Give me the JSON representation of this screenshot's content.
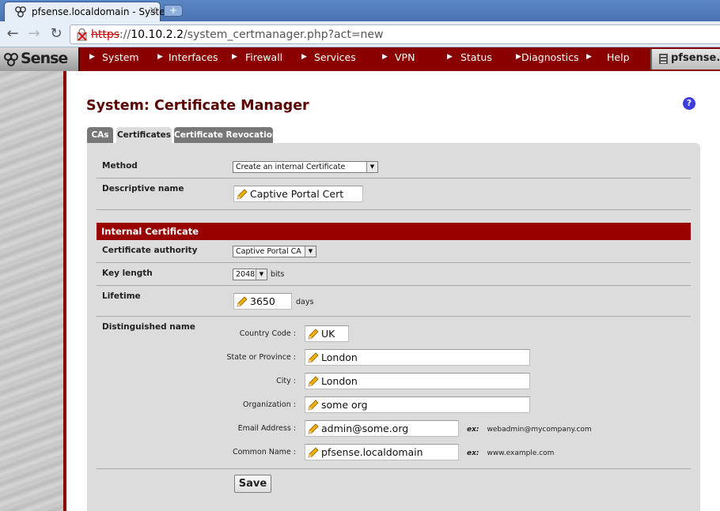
{
  "browser": {
    "tab_title": "pfsense.localdomain - System",
    "tab_close": "×",
    "new_tab": "+",
    "url_scheme": "https",
    "url_rest": "://10.10.2.2/system_certmanager.php?act=new",
    "url_host": "10.10.2.2",
    "url_path": "/system_certmanager.php?act=new"
  },
  "header": {
    "logo_text": "Sense",
    "menu": [
      "System",
      "Interfaces",
      "Firewall",
      "Services",
      "VPN",
      "Status",
      "Diagnostics",
      "Help"
    ],
    "hostname": "pfsense.lo"
  },
  "page": {
    "title": "System: Certificate Manager",
    "help": "?",
    "tabs": [
      "CAs",
      "Certificates",
      "Certificate Revocation"
    ],
    "active_tab": "Certificates"
  },
  "form": {
    "method_label": "Method",
    "method_value": "Create an internal Certificate",
    "descr_label": "Descriptive name",
    "descr_value": "Captive Portal Cert",
    "section_title": "Internal Certificate",
    "ca_label": "Certificate authority",
    "ca_value": "Captive Portal CA",
    "keylen_label": "Key length",
    "keylen_value": "2048",
    "keylen_unit": "bits",
    "lifetime_label": "Lifetime",
    "lifetime_value": "3650",
    "lifetime_unit": "days",
    "dn_label": "Distinguished name",
    "dn": {
      "country_label": "Country Code :",
      "country_value": "UK",
      "state_label": "State or Province :",
      "state_value": "London",
      "city_label": "City :",
      "city_value": "London",
      "org_label": "Organization :",
      "org_value": "some org",
      "email_label": "Email Address :",
      "email_value": "admin@some.org",
      "email_example_prefix": "ex:",
      "email_example": "webadmin@mycompany.com",
      "cn_label": "Common Name :",
      "cn_value": "pfsense.localdomain",
      "cn_example_prefix": "ex:",
      "cn_example": "www.example.com"
    },
    "save_label": "Save"
  },
  "colors": {
    "brand_red": "#8a0000",
    "section_red": "#990000",
    "title_red": "#5a0000"
  }
}
